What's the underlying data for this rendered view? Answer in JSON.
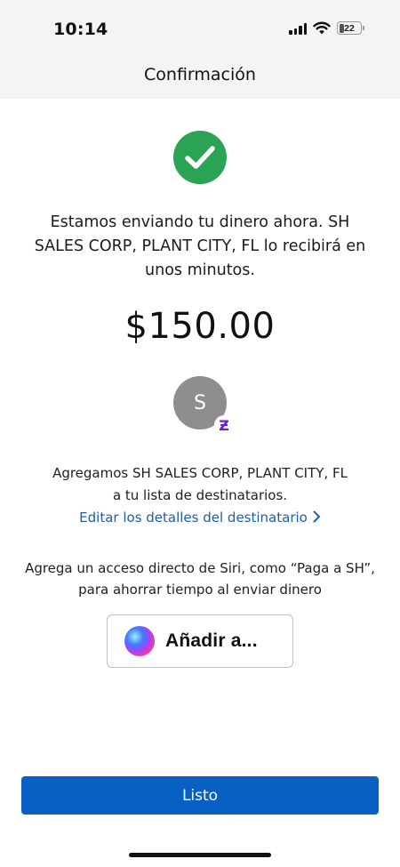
{
  "status_bar": {
    "time": "10:14",
    "battery_level": "22",
    "icons": [
      "cellular-signal-icon",
      "wifi-icon",
      "battery-icon"
    ]
  },
  "header": {
    "title": "Confirmación"
  },
  "confirmation": {
    "icon": "checkmark-circle-icon",
    "message": "Estamos enviando tu dinero ahora. SH SALES CORP, PLANT CITY, FL lo recibirá en unos minutos.",
    "amount": "$150.00"
  },
  "recipient": {
    "avatar_initial": "S",
    "badge_glyph": "Ƶ",
    "added_line1": "Agregamos SH SALES CORP, PLANT CITY, FL",
    "added_line2": "a tu lista de destinatarios.",
    "edit_link": "Editar los detalles del destinatario"
  },
  "siri": {
    "text_line1": "Agrega un acceso directo de Siri, como “Paga a SH”,",
    "text_line2": "para ahorrar tiempo al enviar dinero",
    "button_label": "Añadir a..."
  },
  "actions": {
    "done_label": "Listo"
  },
  "colors": {
    "header_bg": "#f4f4f6",
    "success_green": "#2aa355",
    "link_blue": "#1d5fa8",
    "primary_button": "#0860c4",
    "avatar_gray": "#8e8e8e",
    "zelle_purple": "#6d1ed4"
  }
}
